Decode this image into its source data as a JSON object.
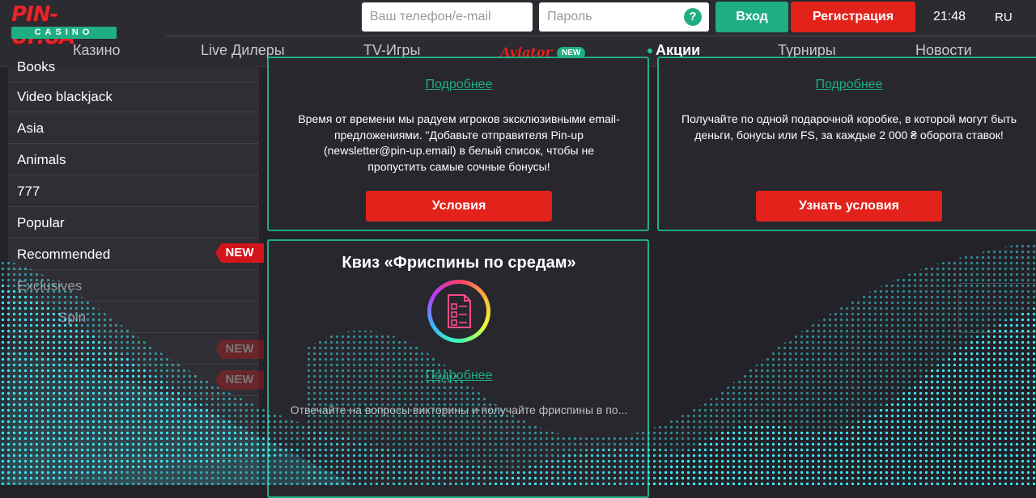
{
  "header": {
    "logo_text": "PIN-UP.UA",
    "logo_sub": "CASINO",
    "phone_placeholder": "Ваш телефон/e-mail",
    "password_placeholder": "Пароль",
    "help": "?",
    "login_label": "Вход",
    "register_label": "Регистрация",
    "time": "21:48",
    "lang": "RU"
  },
  "nav": [
    {
      "label": "Казино"
    },
    {
      "label": "Live Дилеры"
    },
    {
      "label": "TV-Игры"
    },
    {
      "label": "Aviator",
      "badge": "NEW"
    },
    {
      "label": "Акции",
      "active": true
    },
    {
      "label": "Турниры"
    },
    {
      "label": "Новости"
    }
  ],
  "sidebar": {
    "items": [
      {
        "label": "Books"
      },
      {
        "label": "Video blackjack"
      },
      {
        "label": "Asia"
      },
      {
        "label": "Animals"
      },
      {
        "label": "777"
      },
      {
        "label": "Popular"
      },
      {
        "label": "Recommended"
      },
      {
        "label": "Exclusives"
      },
      {
        "label": "Spin"
      }
    ],
    "new_badge": "NEW"
  },
  "cards": [
    {
      "link": "Подробнее",
      "text": "Время от времени мы радуем игроков эксклюзивными email-предложениями. \"Добавьте отправителя Pin-up (newsletter@pin-up.email) в белый список, чтобы не пропустить самые сочные бонусы!",
      "button": "Условия"
    },
    {
      "link": "Подробнее",
      "text": "Получайте по одной подарочной коробке, в которой могут быть деньги, бонусы или FS, за каждые 2 000 ₴ оборота ставок!",
      "button": "Узнать условия"
    },
    {
      "title": "Квиз «Фриспины по средам»",
      "link": "Подробнее",
      "text": "Отвечайте на вопросы викторины и получайте фриспины в по..."
    }
  ],
  "colors": {
    "accent_green": "#1fae82",
    "accent_red": "#e2221b",
    "background": "#222228",
    "wave": "#3ef0ff"
  }
}
